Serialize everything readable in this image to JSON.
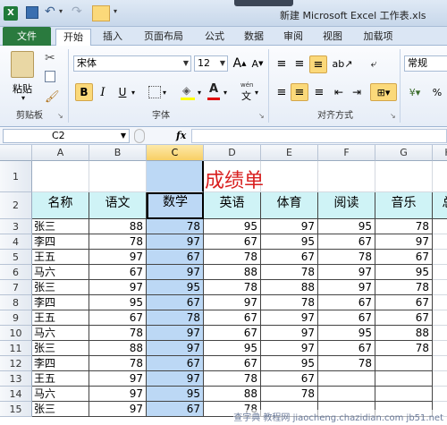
{
  "window": {
    "title": "新建 Microsoft Excel 工作表.xls"
  },
  "tabs": [
    "文件",
    "开始",
    "插入",
    "页面布局",
    "公式",
    "数据",
    "审阅",
    "视图",
    "加载项"
  ],
  "ribbon": {
    "paste": "粘贴",
    "font_name": "宋体",
    "font_size": "12",
    "number_format": "常规",
    "bold": "B",
    "italic": "I",
    "underline": "U",
    "grow_font": "A",
    "shrink_font": "A",
    "wen": "wén",
    "wen_char": "文",
    "groups": {
      "clipboard": "剪贴板",
      "font": "字体",
      "alignment": "对齐方式"
    }
  },
  "formula_bar": {
    "name_box": "C2",
    "fx": "fx",
    "formula": ""
  },
  "columns": [
    "A",
    "B",
    "C",
    "D",
    "E",
    "F",
    "G",
    "H"
  ],
  "selected_column": "C",
  "sheet": {
    "title": "成绩单",
    "headers": [
      "名称",
      "语文",
      "数学",
      "英语",
      "体育",
      "阅读",
      "音乐",
      "总"
    ],
    "rows": [
      {
        "row": "3",
        "name": "张三",
        "vals": [
          "88",
          "78",
          "95",
          "97",
          "95",
          "78"
        ]
      },
      {
        "row": "4",
        "name": "李四",
        "vals": [
          "78",
          "97",
          "67",
          "95",
          "67",
          "97"
        ]
      },
      {
        "row": "5",
        "name": "王五",
        "vals": [
          "97",
          "67",
          "78",
          "67",
          "78",
          "67"
        ]
      },
      {
        "row": "6",
        "name": "马六",
        "vals": [
          "67",
          "97",
          "88",
          "78",
          "97",
          "95"
        ]
      },
      {
        "row": "7",
        "name": "张三",
        "vals": [
          "97",
          "95",
          "78",
          "88",
          "97",
          "78"
        ]
      },
      {
        "row": "8",
        "name": "李四",
        "vals": [
          "95",
          "67",
          "97",
          "78",
          "67",
          "67"
        ]
      },
      {
        "row": "9",
        "name": "王五",
        "vals": [
          "67",
          "78",
          "67",
          "97",
          "67",
          "67"
        ]
      },
      {
        "row": "10",
        "name": "马六",
        "vals": [
          "78",
          "97",
          "67",
          "97",
          "95",
          "88"
        ]
      },
      {
        "row": "11",
        "name": "张三",
        "vals": [
          "88",
          "97",
          "95",
          "97",
          "67",
          "78"
        ]
      },
      {
        "row": "12",
        "name": "李四",
        "vals": [
          "78",
          "67",
          "67",
          "95",
          "78",
          ""
        ]
      },
      {
        "row": "13",
        "name": "王五",
        "vals": [
          "97",
          "97",
          "78",
          "67",
          "",
          ""
        ]
      },
      {
        "row": "14",
        "name": "马六",
        "vals": [
          "97",
          "95",
          "88",
          "78",
          "",
          ""
        ]
      },
      {
        "row": "15",
        "name": "张三",
        "vals": [
          "97",
          "67",
          "78",
          "",
          "",
          ""
        ]
      }
    ]
  },
  "watermark": "查字典 教程网  jiaocheng.chazidian.com  jb51.net",
  "colors": {
    "title_red": "#d81e1e",
    "header_fill": "#cff3f6",
    "selection": "#bcd8f5",
    "file_green": "#2a7a3e"
  }
}
